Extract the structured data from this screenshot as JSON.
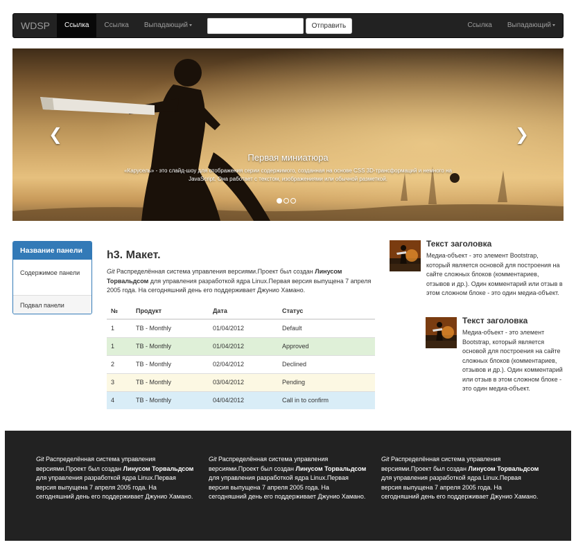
{
  "navbar": {
    "brand": "WDSP",
    "items": [
      "Ссылка",
      "Ссылка",
      "Выпадающий"
    ],
    "search_placeholder": "",
    "submit_label": "Отправить",
    "right_items": [
      "Ссылка",
      "Выпадающий"
    ]
  },
  "carousel": {
    "prev_glyph": "❮",
    "next_glyph": "❯",
    "caption_title": "Первая миниатюра",
    "caption_text": "«Карусель» - это слайд-шоу для отображения серии содержимого, созданная на основе CSS 3D-трансформаций и немного на JavaScript. Она работает с текстом, изображениями или обычной разметкой.",
    "slide_count": 3,
    "active_slide": 1
  },
  "panel": {
    "heading": "Название панели",
    "body": "Содержимое панели",
    "footer": "Подвал панели"
  },
  "main": {
    "heading": "h3. Макет.",
    "intro": {
      "em": "Git",
      "text1": " Распределённая система управления версиями.Проект был создан ",
      "strong": "Линусом Торвальдсом",
      "text2": " для управления разработкой ядра Linux.Первая версия выпущена 7 апреля 2005 года. На сегодняшний день его поддерживает Джунио Хамано."
    }
  },
  "table": {
    "headers": [
      "№",
      "Продукт",
      "Дата",
      "Статус"
    ],
    "rows": [
      {
        "num": "1",
        "product": "TB - Monthly",
        "date": "01/04/2012",
        "status": "Default"
      },
      {
        "num": "1",
        "product": "TB - Monthly",
        "date": "01/04/2012",
        "status": "Approved"
      },
      {
        "num": "2",
        "product": "TB - Monthly",
        "date": "02/04/2012",
        "status": "Declined"
      },
      {
        "num": "3",
        "product": "TB - Monthly",
        "date": "03/04/2012",
        "status": "Pending"
      },
      {
        "num": "4",
        "product": "TB - Monthly",
        "date": "04/04/2012",
        "status": "Call in to confirm"
      }
    ]
  },
  "media": [
    {
      "heading": "Текст заголовка",
      "text": "Медиа-объект - это элемент Bootstrap, который является основой для построения на сайте сложных блоков (комментариев, отзывов и др.). Один комментарий или отзыв в этом сложном блоке - это один медиа-объект."
    },
    {
      "heading": "Текст заголовка",
      "text": "Медиа-объект - это элемент Bootstrap, который является основой для построения на сайте сложных блоков (комментариев, отзывов и др.). Один комментарий или отзыв в этом сложном блоке - это один медиа-объект."
    }
  ],
  "footer": {
    "columns": [
      {
        "em": "Git",
        "text1": " Распределённая система управления версиями.Проект был создан ",
        "strong": "Линусом Торвальдсом",
        "text2": " для управления разработкой ядра Linux.Первая версия выпущена 7 апреля 2005 года. На сегодняшний день его поддерживает Джунио Хамано."
      },
      {
        "em": "Git",
        "text1": " Распределённая система управления версиями.Проект был создан ",
        "strong": "Линусом Торвальдсом",
        "text2": " для управления разработкой ядра Linux.Первая версия выпущена 7 апреля 2005 года. На сегодняшний день его поддерживает Джунио Хамано."
      },
      {
        "em": "Git",
        "text1": " Распределённая система управления версиями.Проект был создан ",
        "strong": "Линусом Торвальдсом",
        "text2": " для управления разработкой ядра Linux.Первая версия выпущена 7 апреля 2005 года. На сегодняшний день его поддерживает Джунио Хамано."
      }
    ]
  },
  "colors": {
    "navbar_bg": "#222222",
    "primary": "#337ab7",
    "success_row": "#dff0d8",
    "warning_row": "#fcf8e3",
    "info_row": "#d9edf7"
  }
}
